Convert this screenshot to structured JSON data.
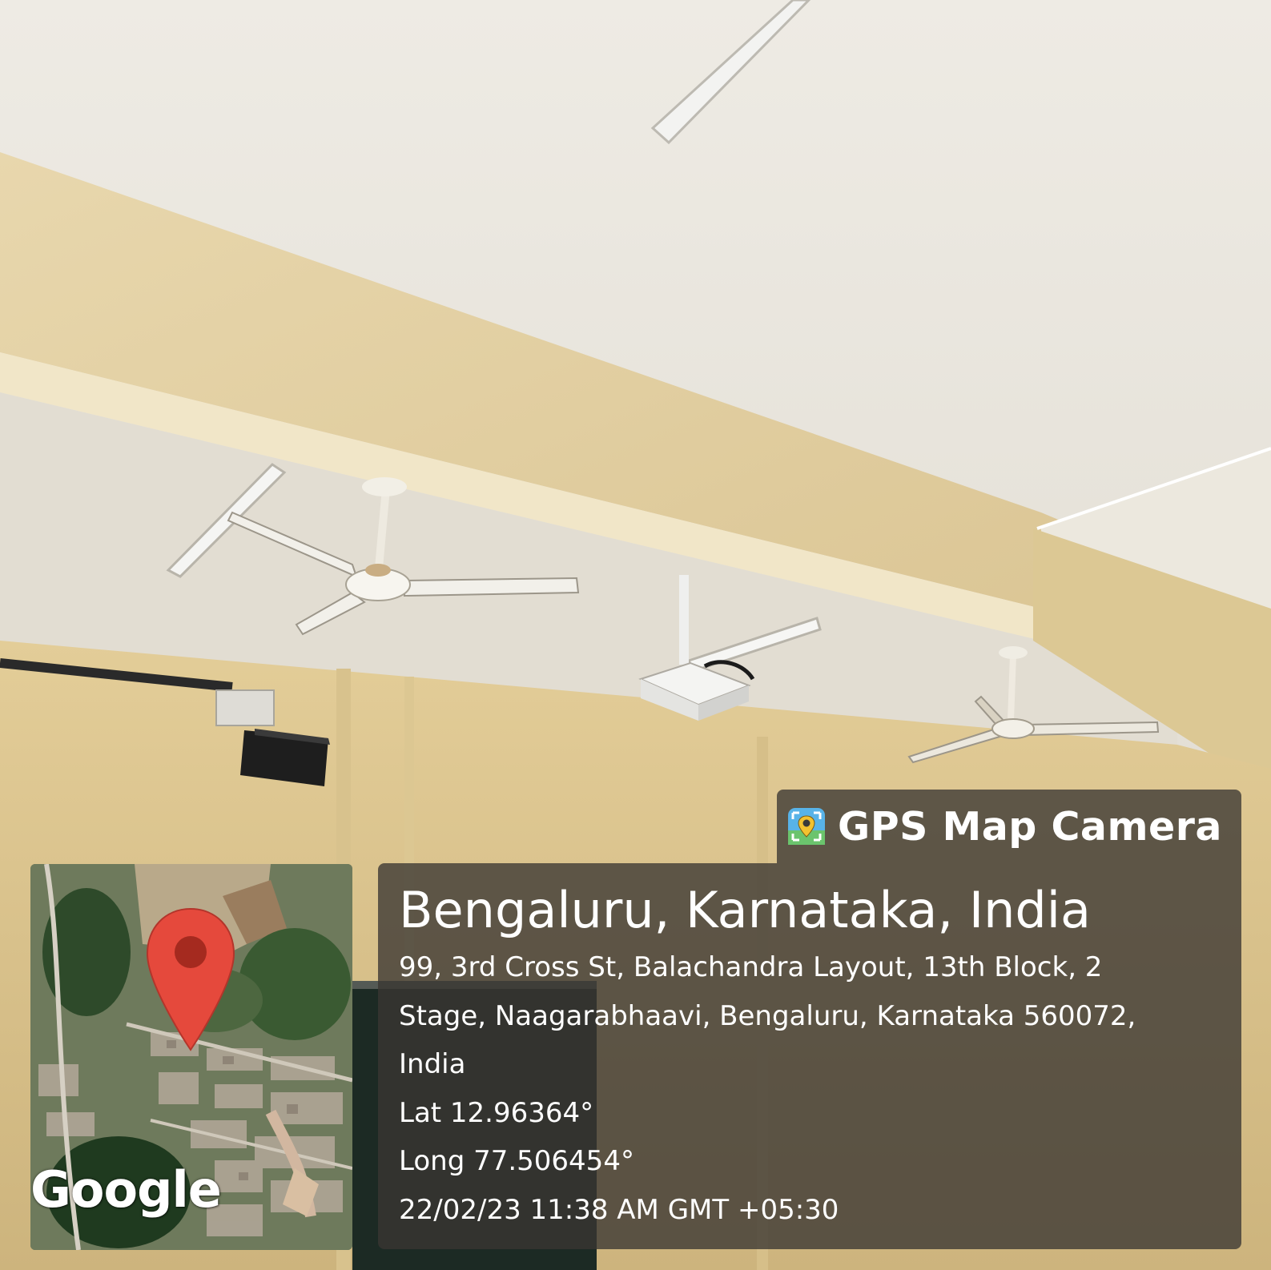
{
  "app": {
    "name": "GPS Map Camera",
    "icon": "gps-map-camera-icon"
  },
  "location": {
    "place": "Bengaluru, Karnataka, India",
    "address_line1": "99, 3rd Cross St, Balachandra Layout, 13th Block, 2",
    "address_line2": "Stage, Naagarabhaavi, Bengaluru, Karnataka 560072,",
    "address_line3": "India",
    "latitude": "Lat 12.96364°",
    "longitude": "Long 77.506454°",
    "datetime": "22/02/23 11:38 AM GMT +05:30"
  },
  "map": {
    "provider": "Google",
    "marker": "map-pin-icon",
    "marker_color": "#e5493c"
  },
  "colors": {
    "panel": "#3a3632",
    "wall": "#e9d6a8",
    "ceiling": "#e6e3dc"
  }
}
